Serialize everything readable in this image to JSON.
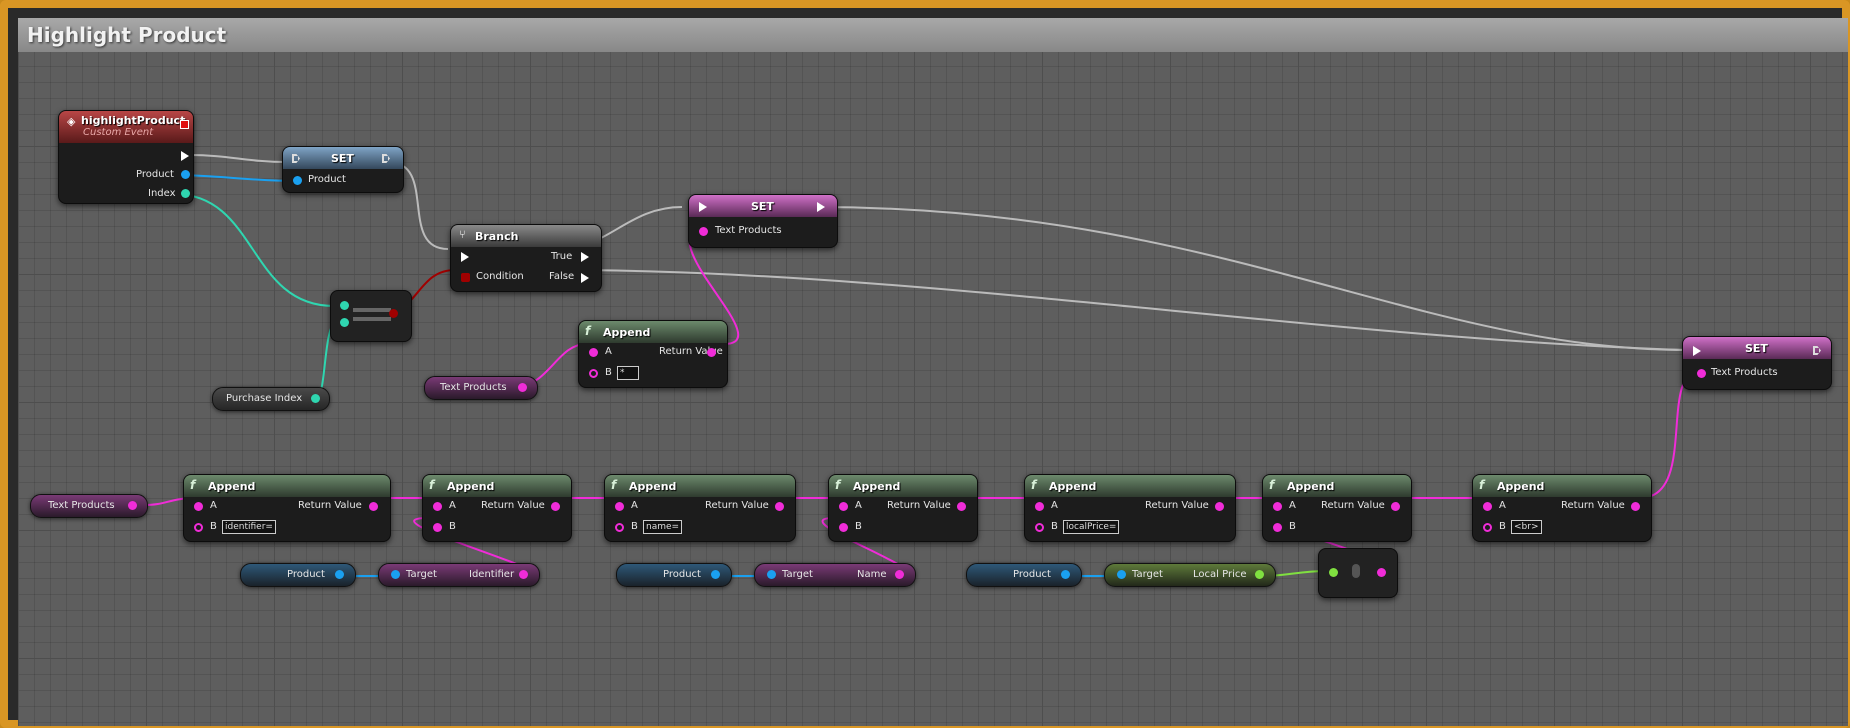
{
  "window_title": "Highlight Product",
  "event_node": {
    "name": "highlightProduct",
    "subtitle": "Custom Event",
    "pins": [
      "Product",
      "Index"
    ]
  },
  "set_product": {
    "title": "SET",
    "pin": "Product"
  },
  "branch": {
    "title": "Branch",
    "condition": "Condition",
    "true_label": "True",
    "false_label": "False"
  },
  "set_text_1": {
    "title": "SET",
    "pin": "Text Products"
  },
  "set_text_2": {
    "title": "SET",
    "pin": "Text Products"
  },
  "purchase_index": {
    "label": "Purchase Index"
  },
  "top_append": {
    "title": "Append",
    "a": "A",
    "b": "B",
    "ret": "Return Value",
    "b_value": "*"
  },
  "text_products_var_1": {
    "label": "Text Products"
  },
  "text_products_var_2": {
    "label": "Text Products"
  },
  "append_chain": [
    {
      "title": "Append",
      "a": "A",
      "b": "B",
      "ret": "Return Value",
      "b_value": "identifier="
    },
    {
      "title": "Append",
      "a": "A",
      "b": "B",
      "ret": "Return Value",
      "b_value": ""
    },
    {
      "title": "Append",
      "a": "A",
      "b": "B",
      "ret": "Return Value",
      "b_value": "name="
    },
    {
      "title": "Append",
      "a": "A",
      "b": "B",
      "ret": "Return Value",
      "b_value": ""
    },
    {
      "title": "Append",
      "a": "A",
      "b": "B",
      "ret": "Return Value",
      "b_value": "localPrice="
    },
    {
      "title": "Append",
      "a": "A",
      "b": "B",
      "ret": "Return Value",
      "b_value": ""
    },
    {
      "title": "Append",
      "a": "A",
      "b": "B",
      "ret": "Return Value",
      "b_value": "<br>"
    }
  ],
  "getters": [
    {
      "product": "Product",
      "target": "Target",
      "field": "Identifier"
    },
    {
      "product": "Product",
      "target": "Target",
      "field": "Name"
    },
    {
      "product": "Product",
      "target": "Target",
      "field": "Local Price"
    }
  ],
  "colors": {
    "string_pin": "#f02cd8",
    "object_pin": "#1aa0f0",
    "int_pin": "#2fd6b0",
    "float_pin": "#80e040",
    "bool_pin": "#a00000",
    "border": "#d99624"
  }
}
